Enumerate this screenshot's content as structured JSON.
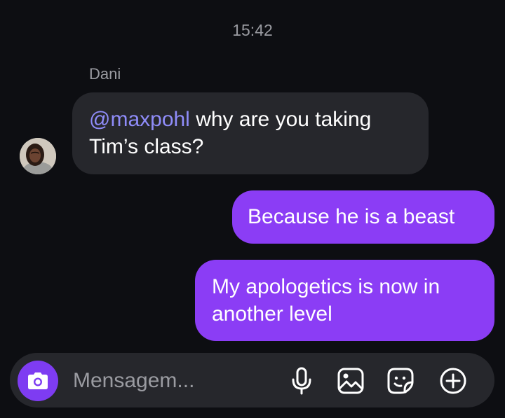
{
  "thread": {
    "timestamp": "15:42"
  },
  "messages": {
    "incoming": {
      "sender": "Dani",
      "mention": "@maxpohl",
      "text_line1_rest": " why are you taking",
      "text_line2": "Tim’s class?"
    },
    "outgoing": [
      {
        "text": "Because he is a beast"
      },
      {
        "text": "My apologetics is now in another level"
      }
    ]
  },
  "composer": {
    "placeholder": "Mensagem...",
    "icons": [
      "camera-icon",
      "microphone-icon",
      "gallery-icon",
      "sticker-icon",
      "plus-circle-icon"
    ]
  },
  "colors": {
    "background": "#0d0e12",
    "incoming_bubble": "#26272c",
    "outgoing_bubble": "#8b3df5",
    "mention": "#8f8cf9",
    "camera_button": "#7e3cf2"
  }
}
